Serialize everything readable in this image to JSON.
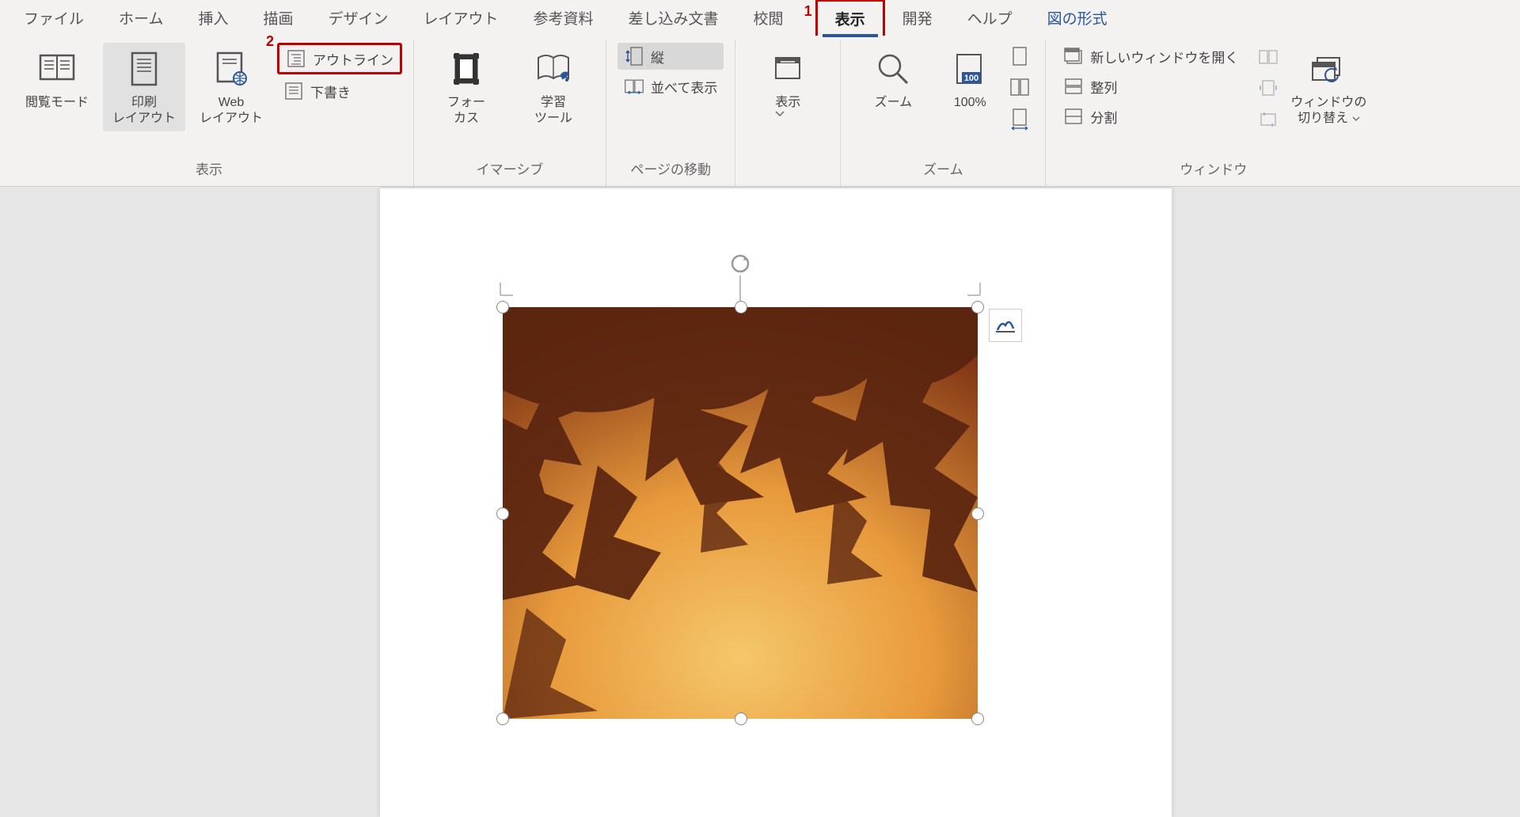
{
  "annotations": {
    "tab": "1",
    "outline": "2"
  },
  "tabs": {
    "file": "ファイル",
    "home": "ホーム",
    "insert": "挿入",
    "draw": "描画",
    "design": "デザイン",
    "layout": "レイアウト",
    "references": "参考資料",
    "mailings": "差し込み文書",
    "review": "校閲",
    "view": "表示",
    "developer": "開発",
    "help": "ヘルプ",
    "picture_format": "図の形式"
  },
  "view": {
    "reading_mode": "閲覧モード",
    "print_layout": "印刷\nレイアウト",
    "web_layout": "Web\nレイアウト",
    "outline": "アウトライン",
    "draft": "下書き",
    "focus": "フォー\nカス",
    "learning_tools": "学習\nツール",
    "vertical": "縦",
    "side_by_side": "並べて表示",
    "show": "表示",
    "zoom": "ズーム",
    "hundred": "100%",
    "new_window": "新しいウィンドウを開く",
    "arrange": "整列",
    "split": "分割",
    "switch_windows": "ウィンドウの\n切り替え"
  },
  "groups": {
    "views": "表示",
    "immersive": "イマーシブ",
    "page_movement": "ページの移動",
    "zoom": "ズーム",
    "window": "ウィンドウ"
  },
  "icons": {
    "reading": "reading-mode-icon",
    "print": "print-layout-icon",
    "web": "web-layout-icon",
    "outline": "outline-icon",
    "draft": "draft-icon",
    "focus": "focus-icon",
    "learning": "learning-tools-icon",
    "vertical": "vertical-icon",
    "sidebyside": "side-by-side-icon",
    "show": "show-icon",
    "zoom": "zoom-icon",
    "hundred": "100-percent-icon",
    "onepage": "one-page-icon",
    "multipage": "multi-page-icon",
    "pagewidth": "page-width-icon",
    "newwin": "new-window-icon",
    "arrange": "arrange-all-icon",
    "split": "split-icon",
    "sidebyside2": "view-side-by-side-icon",
    "sync": "sync-scroll-icon",
    "reset": "reset-window-icon",
    "switch": "switch-windows-icon",
    "rotate": "rotate-handle-icon",
    "layoutopt": "layout-options-icon"
  }
}
